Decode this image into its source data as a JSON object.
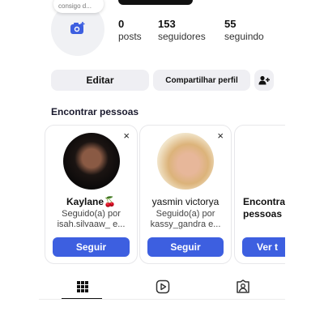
{
  "profile": {
    "note_text": "consigo d...",
    "stats": {
      "posts": {
        "value": "0",
        "label": "posts"
      },
      "followers": {
        "value": "153",
        "label": "seguidores"
      },
      "following": {
        "value": "55",
        "label": "seguindo"
      }
    }
  },
  "actions": {
    "edit_label": "Editar",
    "share_label": "Compartilhar perfil",
    "add_user_icon": "add-person-icon"
  },
  "suggestions": {
    "title": "Encontrar pessoas",
    "cards": [
      {
        "name": "Kaylane",
        "emoji": "🍒",
        "sub_line1": "Seguido(a) por",
        "sub_line2": "isah.silvaaw_ e...",
        "button": "Seguir"
      },
      {
        "name": "yasmin victorya",
        "sub_line1": "Seguido(a) por",
        "sub_line2": "kassy_gandra e...",
        "button": "Seguir"
      },
      {
        "name": "Encontra",
        "sub_line1": "pessoas",
        "button": "Ver t"
      }
    ],
    "close_glyph": "×"
  },
  "tabs": [
    {
      "name": "grid",
      "icon": "grid-icon",
      "active": true
    },
    {
      "name": "reels",
      "icon": "reels-icon",
      "active": false
    },
    {
      "name": "tagged",
      "icon": "tagged-icon",
      "active": false
    }
  ],
  "colors": {
    "accent": "#3d5fe0",
    "button_bg": "#efeff3",
    "camera_icon": "#3d5fe0"
  }
}
